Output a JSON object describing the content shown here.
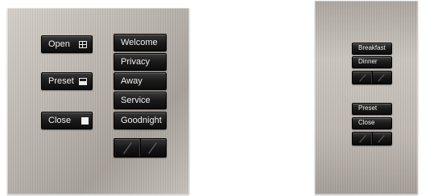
{
  "large_keypad": {
    "left_buttons": [
      {
        "label": "Open",
        "icon": "grid-icon"
      },
      {
        "label": "Preset",
        "icon": "half-fill-icon"
      },
      {
        "label": "Close",
        "icon": "square-icon"
      }
    ],
    "right_buttons": [
      "Welcome",
      "Privacy",
      "Away",
      "Service",
      "Goodnight"
    ],
    "rocker": {
      "lower": "down-raise-lower",
      "raise": "up-raise-lower"
    }
  },
  "small_keypad": {
    "upper_group": [
      "Breakfast",
      "Dinner"
    ],
    "lower_group": [
      "Preset",
      "Close"
    ]
  },
  "colors": {
    "button": "#1a1a1a",
    "label": "#f2f2f2",
    "plate": "#bdb7b0"
  }
}
